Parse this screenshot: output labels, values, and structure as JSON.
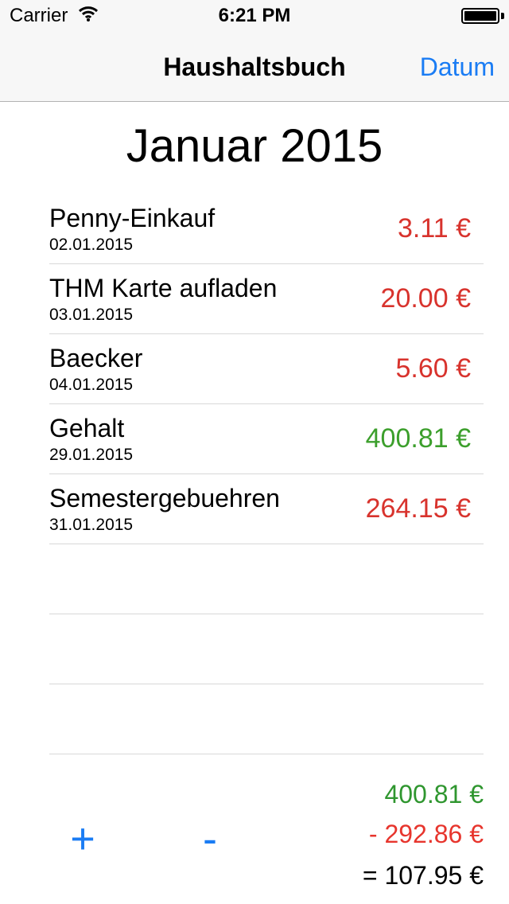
{
  "status_bar": {
    "carrier": "Carrier",
    "time": "6:21 PM"
  },
  "nav": {
    "title": "Haushaltsbuch",
    "right_button": "Datum",
    "accent_color": "#1a7cf4"
  },
  "month_title": "Januar 2015",
  "entries": [
    {
      "title": "Penny-Einkauf",
      "date": "02.01.2015",
      "amount": "3.11 €",
      "type": "expense"
    },
    {
      "title": "THM Karte aufladen",
      "date": "03.01.2015",
      "amount": "20.00 €",
      "type": "expense"
    },
    {
      "title": "Baecker",
      "date": "04.01.2015",
      "amount": "5.60 €",
      "type": "expense"
    },
    {
      "title": "Gehalt",
      "date": "29.01.2015",
      "amount": "400.81 €",
      "type": "income"
    },
    {
      "title": "Semestergebuehren",
      "date": "31.01.2015",
      "amount": "264.15 €",
      "type": "expense"
    }
  ],
  "empty_rows": 3,
  "actions": {
    "add_label": "+",
    "subtract_label": "-"
  },
  "summary": {
    "income": "400.81 €",
    "expense": "- 292.86 €",
    "total": "= 107.95 €"
  },
  "colors": {
    "income": "#3c9f2c",
    "expense": "#d8332d"
  }
}
